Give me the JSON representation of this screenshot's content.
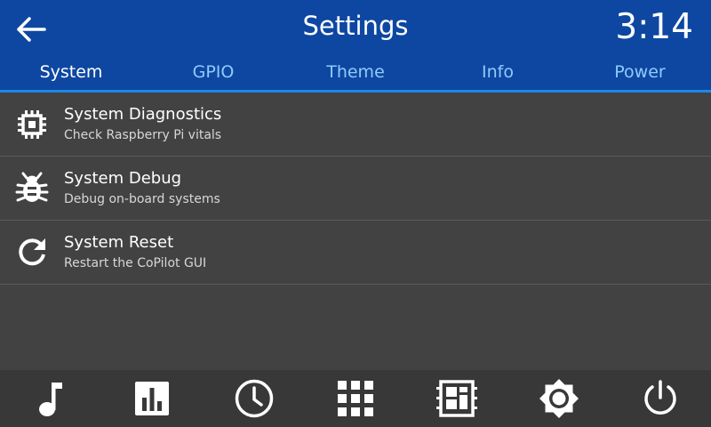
{
  "header": {
    "title": "Settings",
    "time": "3:14",
    "back_icon": "arrow-back-icon"
  },
  "tabs": [
    {
      "label": "System",
      "active": true
    },
    {
      "label": "GPIO",
      "active": false
    },
    {
      "label": "Theme",
      "active": false
    },
    {
      "label": "Info",
      "active": false
    },
    {
      "label": "Power",
      "active": false
    }
  ],
  "items": [
    {
      "title": "System Diagnostics",
      "subtitle": "Check Raspberry Pi vitals",
      "icon": "chip-icon"
    },
    {
      "title": "System Debug",
      "subtitle": "Debug on-board systems",
      "icon": "bug-icon"
    },
    {
      "title": "System Reset",
      "subtitle": "Restart the CoPilot GUI",
      "icon": "refresh-icon"
    }
  ],
  "bottom_nav": [
    {
      "icon": "music-note-icon"
    },
    {
      "icon": "bar-chart-icon"
    },
    {
      "icon": "clock-icon"
    },
    {
      "icon": "apps-grid-icon"
    },
    {
      "icon": "dashboard-icon"
    },
    {
      "icon": "brightness-icon"
    },
    {
      "icon": "power-icon"
    }
  ],
  "colors": {
    "header": "#0d47a1",
    "tab_inactive": "#90caf9",
    "background": "#424242",
    "bottom_bar": "#383838"
  }
}
